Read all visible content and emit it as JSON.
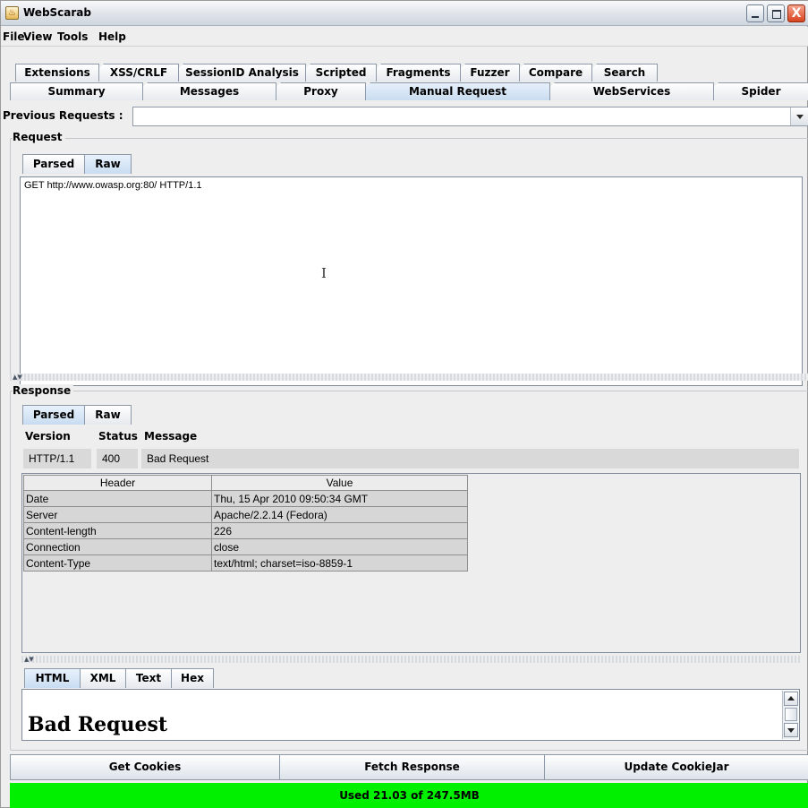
{
  "window": {
    "title": "WebScarab",
    "close_glyph": "X"
  },
  "menu": [
    "File",
    "View",
    "Tools",
    "Help"
  ],
  "tabs_top": [
    "Extensions",
    "XSS/CRLF",
    "SessionID Analysis",
    "Scripted",
    "Fragments",
    "Fuzzer",
    "Compare",
    "Search"
  ],
  "tabs_main": [
    "Summary",
    "Messages",
    "Proxy",
    "Manual Request",
    "WebServices",
    "Spider"
  ],
  "previous_requests": {
    "label": "Previous Requests :",
    "value": ""
  },
  "request": {
    "title": "Request",
    "tabs": [
      "Parsed",
      "Raw"
    ],
    "raw_text": "GET http://www.owasp.org:80/ HTTP/1.1"
  },
  "response": {
    "title": "Response",
    "tabs": [
      "Parsed",
      "Raw"
    ],
    "status_headers": [
      "Version",
      "Status",
      "Message"
    ],
    "status_values": [
      "HTTP/1.1",
      "400",
      "Bad Request"
    ],
    "header_columns": [
      "Header",
      "Value"
    ],
    "headers": [
      [
        "Date",
        "Thu, 15 Apr 2010 09:50:34 GMT"
      ],
      [
        "Server",
        "Apache/2.2.14 (Fedora)"
      ],
      [
        "Content-length",
        "226"
      ],
      [
        "Connection",
        "close"
      ],
      [
        "Content-Type",
        "text/html; charset=iso-8859-1"
      ]
    ],
    "body_tabs": [
      "HTML",
      "XML",
      "Text",
      "Hex"
    ],
    "body_html": "Bad Request"
  },
  "buttons": [
    "Get Cookies",
    "Fetch Response",
    "Update CookieJar"
  ],
  "status_bar": "Used 21.03 of 247.5MB",
  "colors": {
    "status_green": "#00f000",
    "selected_tab": "#c9dcf0"
  }
}
